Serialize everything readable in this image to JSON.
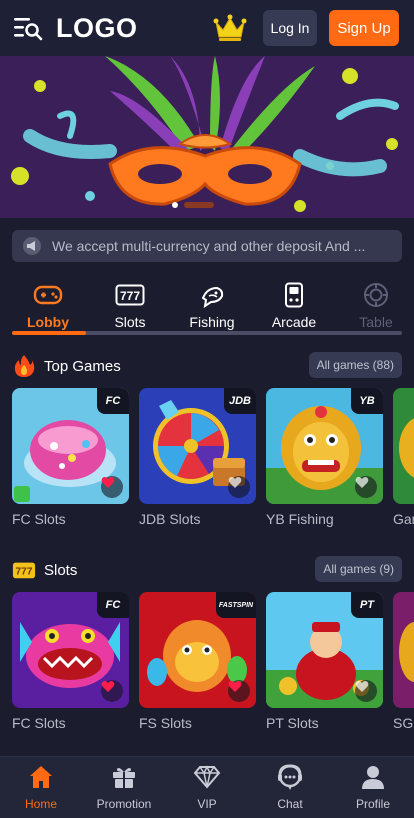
{
  "header": {
    "logo_text": "LOGO",
    "login_label": "Log In",
    "signup_label": "Sign Up"
  },
  "banner": {
    "slide_count": 3,
    "active_slide": 2
  },
  "notice": {
    "text": "We accept multi-currency and other deposit And ..."
  },
  "tabs": [
    {
      "label": "Lobby",
      "icon": "gamepad-icon",
      "active": true
    },
    {
      "label": "Slots",
      "icon": "777-icon",
      "active": false
    },
    {
      "label": "Fishing",
      "icon": "fish-icon",
      "active": false
    },
    {
      "label": "Arcade",
      "icon": "arcade-icon",
      "active": false
    },
    {
      "label": "Table",
      "icon": "poker-chip-icon",
      "active": false
    }
  ],
  "sections": [
    {
      "title": "Top Games",
      "icon": "fire-icon",
      "all_label": "All games (88)",
      "games": [
        {
          "name": "FC Slots",
          "provider": "FC",
          "favorite": true
        },
        {
          "name": "JDB Slots",
          "provider": "JDB",
          "favorite": false
        },
        {
          "name": "YB Fishing",
          "provider": "YB",
          "favorite": false
        },
        {
          "name": "Gam",
          "provider": "",
          "favorite": false
        }
      ]
    },
    {
      "title": "Slots",
      "icon": "777-icon",
      "all_label": "All games (9)",
      "games": [
        {
          "name": "FC Slots",
          "provider": "FC",
          "favorite": true
        },
        {
          "name": "FS Slots",
          "provider": "FASTSPIN",
          "favorite": true
        },
        {
          "name": "PT Slots",
          "provider": "PT",
          "favorite": false
        },
        {
          "name": "SG",
          "provider": "",
          "favorite": false
        }
      ]
    }
  ],
  "bottom_nav": [
    {
      "label": "Home",
      "icon": "home-icon",
      "active": true
    },
    {
      "label": "Promotion",
      "icon": "gift-icon",
      "active": false
    },
    {
      "label": "VIP",
      "icon": "diamond-icon",
      "active": false
    },
    {
      "label": "Chat",
      "icon": "chat-icon",
      "active": false
    },
    {
      "label": "Profile",
      "icon": "user-icon",
      "active": false
    }
  ],
  "colors": {
    "accent": "#ff6a13",
    "background": "#1b1d2e",
    "header": "#1e2036",
    "nav": "#232538"
  }
}
